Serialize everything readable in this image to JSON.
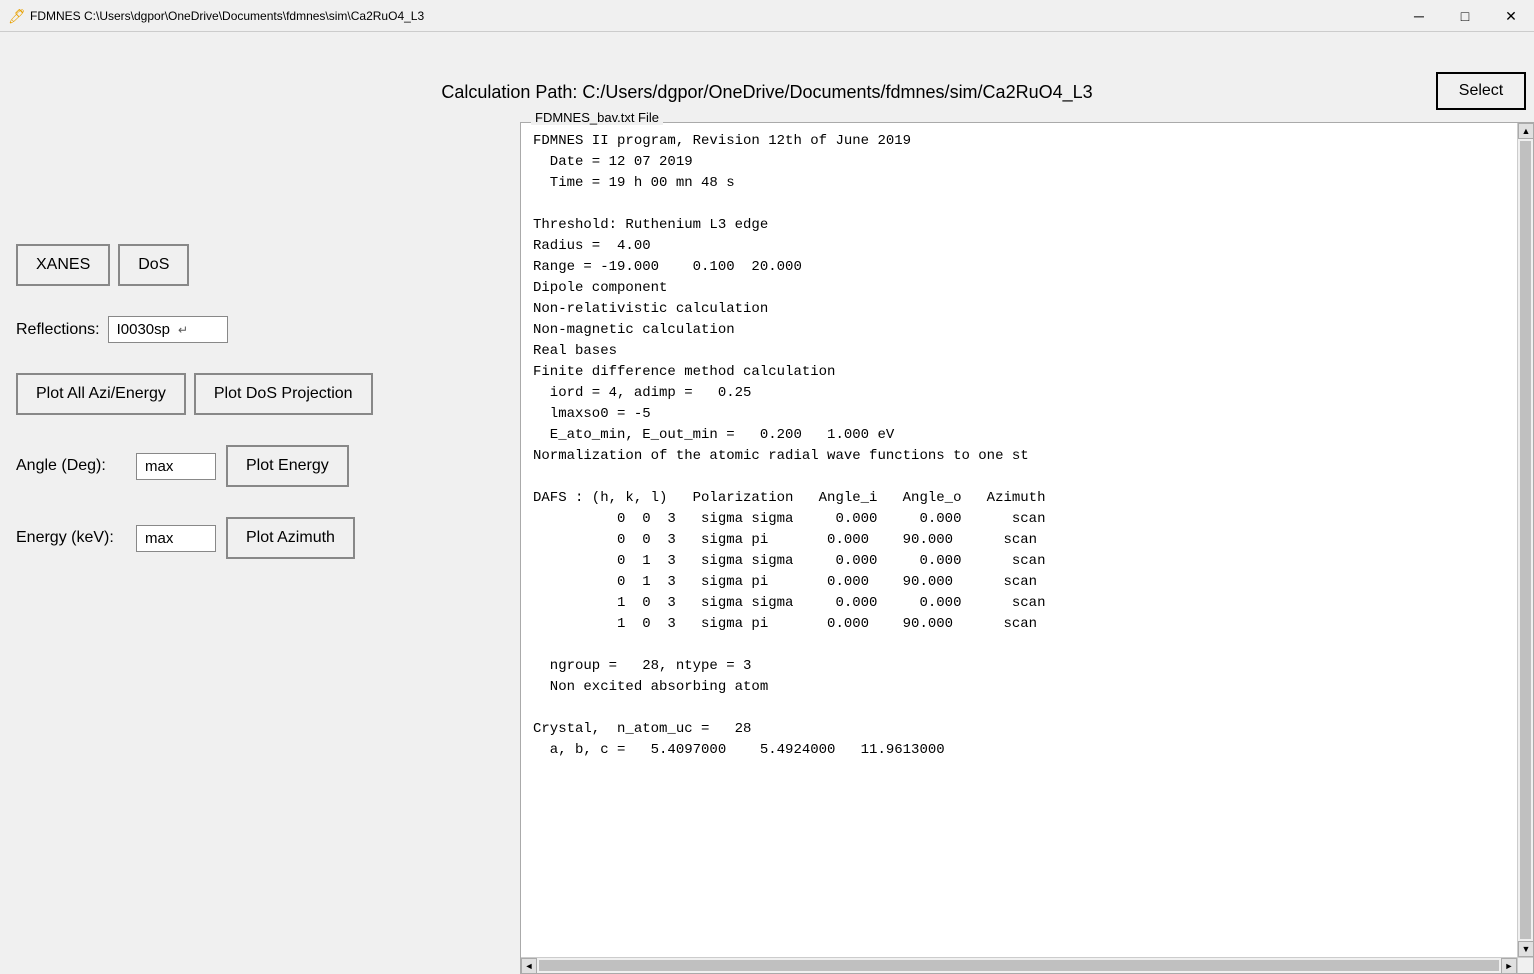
{
  "titlebar": {
    "title": "FDMNES C:\\Users\\dgpor\\OneDrive\\Documents\\fdmnes\\sim\\Ca2RuO4_L3",
    "icon": "🖊",
    "minimize": "─",
    "maximize": "□",
    "close": "✕"
  },
  "header": {
    "calc_path_label": "Calculation Path: C:/Users/dgpor/OneDrive/Documents/fdmnes/sim/Ca2RuO4_L3",
    "select_btn": "Select"
  },
  "left_panel": {
    "xanes_btn": "XANES",
    "dos_btn": "DoS",
    "reflections_label": "Reflections:",
    "reflections_value": "I0030sp",
    "reflections_arrow": "↵",
    "plot_all_btn": "Plot All Azi/Energy",
    "plot_dos_btn": "Plot DoS Projection",
    "angle_label": "Angle (Deg):",
    "angle_value": "max",
    "plot_energy_btn": "Plot Energy",
    "energy_label": "Energy (keV):",
    "energy_value": "max",
    "plot_azimuth_btn": "Plot Azimuth"
  },
  "file_panel": {
    "label": "FDMNES_bav.txt File",
    "content": "FDMNES II program, Revision 12th of June 2019\n  Date = 12 07 2019\n  Time = 19 h 00 mn 48 s\n\nThreshold: Ruthenium L3 edge\nRadius =  4.00\nRange = -19.000    0.100  20.000\nDipole component\nNon-relativistic calculation\nNon-magnetic calculation\nReal bases\nFinite difference method calculation\n  iord = 4, adimp =   0.25\n  lmaxso0 = -5\n  E_ato_min, E_out_min =   0.200   1.000 eV\nNormalization of the atomic radial wave functions to one st\n\nDAFS : (h, k, l)   Polarization   Angle_i   Angle_o   Azimuth\n          0  0  3   sigma sigma     0.000     0.000      scan\n          0  0  3   sigma pi       0.000    90.000      scan\n          0  1  3   sigma sigma     0.000     0.000      scan\n          0  1  3   sigma pi       0.000    90.000      scan\n          1  0  3   sigma sigma     0.000     0.000      scan\n          1  0  3   sigma pi       0.000    90.000      scan\n\n  ngroup =   28, ntype = 3\n  Non excited absorbing atom\n\nCrystal,  n_atom_uc =   28\n  a, b, c =   5.4097000    5.4924000   11.9613000"
  }
}
